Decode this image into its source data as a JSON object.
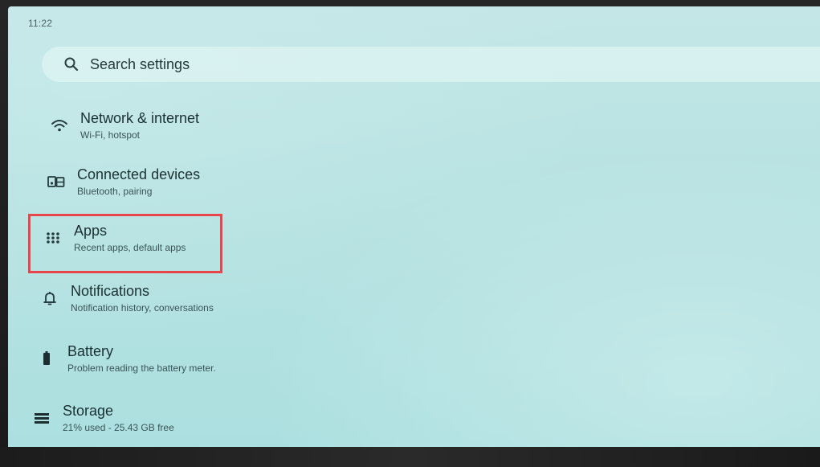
{
  "status_bar": {
    "time": "11:22"
  },
  "search": {
    "label": "Search settings"
  },
  "settings": [
    {
      "title": "Network & internet",
      "subtitle": "Wi-Fi, hotspot",
      "icon": "wifi-icon"
    },
    {
      "title": "Connected devices",
      "subtitle": "Bluetooth, pairing",
      "icon": "connected-devices-icon"
    },
    {
      "title": "Apps",
      "subtitle": "Recent apps, default apps",
      "icon": "apps-grid-icon"
    },
    {
      "title": "Notifications",
      "subtitle": "Notification history, conversations",
      "icon": "bell-icon"
    },
    {
      "title": "Battery",
      "subtitle": "Problem reading the battery meter.",
      "icon": "battery-icon"
    },
    {
      "title": "Storage",
      "subtitle": "21% used - 25.43 GB free",
      "icon": "storage-icon"
    }
  ],
  "colors": {
    "highlight_border": "#e8454b",
    "background": "#b8e2e2"
  }
}
